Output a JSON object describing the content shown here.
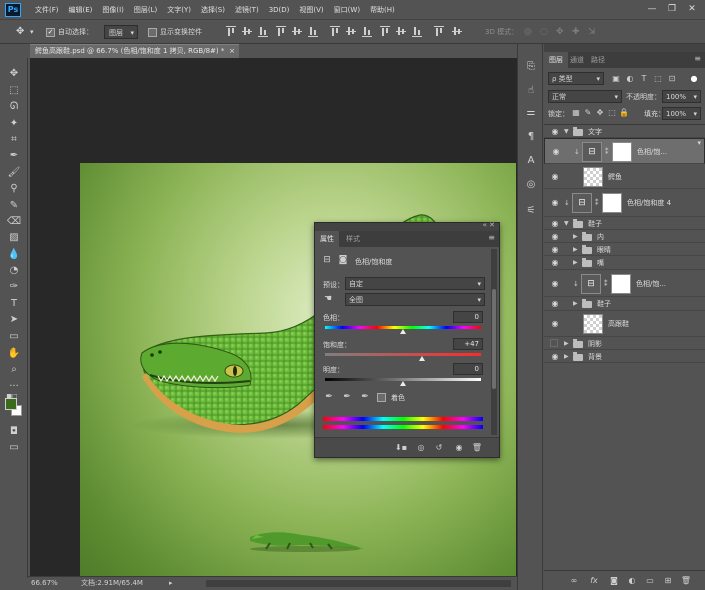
{
  "app": {
    "logo": "Ps"
  },
  "menu": [
    "文件(F)",
    "编辑(E)",
    "图像(I)",
    "图层(L)",
    "文字(Y)",
    "选择(S)",
    "滤镜(T)",
    "3D(D)",
    "视图(V)",
    "窗口(W)",
    "帮助(H)"
  ],
  "window_controls": {
    "minimize": "—",
    "restore": "❐",
    "close": "✕"
  },
  "options": {
    "auto_select_label": "自动选择：",
    "auto_select_checked": true,
    "auto_select_target": "图层",
    "show_transform_label": "显示变换控件",
    "mode_3d_label": "3D 模式："
  },
  "document": {
    "tab_title": "鳄鱼高跟鞋.psd @ 66.7% (色相/饱和度 1 拷贝, RGB/8#) *",
    "tab_close": "×",
    "zoom": "66.67%",
    "doc_info": "文档:2.91M/65.4M"
  },
  "layers_panel": {
    "tabs": [
      "图层",
      "通道",
      "路径"
    ],
    "active_tab": 0,
    "filter_kind": "ρ 类型",
    "blend_mode": "正常",
    "opacity_label": "不透明度：",
    "opacity_value": "100%",
    "lock_label": "锁定：",
    "fill_label": "填充：",
    "fill_value": "100%",
    "layers": [
      {
        "name": "文字",
        "kind": "group",
        "level": 0,
        "visible": true,
        "expanded": true
      },
      {
        "name": "色相/饱...",
        "kind": "adjustment",
        "level": 1,
        "visible": true,
        "selected": true,
        "clipped": true
      },
      {
        "name": "鳄鱼",
        "kind": "pixel",
        "level": 1,
        "visible": true
      },
      {
        "name": "色相/饱和度 4",
        "kind": "adjustment",
        "level": 0,
        "visible": true,
        "clipped": true
      },
      {
        "name": "鞋子",
        "kind": "group",
        "level": 0,
        "visible": true,
        "expanded": true
      },
      {
        "name": "内",
        "kind": "group",
        "level": 1,
        "visible": true,
        "expanded": false
      },
      {
        "name": "眼睛",
        "kind": "group",
        "level": 1,
        "visible": true,
        "expanded": false
      },
      {
        "name": "嘴",
        "kind": "group",
        "level": 1,
        "visible": true,
        "expanded": false
      },
      {
        "name": "色相/饱...",
        "kind": "adjustment",
        "level": 1,
        "visible": true,
        "clipped": true
      },
      {
        "name": "鞋子",
        "kind": "group",
        "level": 1,
        "visible": true,
        "expanded": false
      },
      {
        "name": "高跟鞋",
        "kind": "pixel",
        "level": 1,
        "visible": true
      },
      {
        "name": "阴影",
        "kind": "group",
        "level": 0,
        "visible": false,
        "expanded": false
      },
      {
        "name": "背景",
        "kind": "group",
        "level": 0,
        "visible": true,
        "expanded": false
      }
    ]
  },
  "properties": {
    "tabs": [
      "属性",
      "样式"
    ],
    "active_tab": 0,
    "adjustment_title": "色相/饱和度",
    "preset_label": "预设：",
    "preset_value": "自定",
    "channel_value": "全图",
    "hue_label": "色相：",
    "hue_value": "0",
    "saturation_label": "饱和度：",
    "saturation_value": "+47",
    "lightness_label": "明度：",
    "lightness_value": "0",
    "colorize_label": "着色",
    "colorize_checked": false,
    "slider_levels": {
      "hue": 0.5,
      "saturation": 0.62,
      "lightness": 0.5
    }
  },
  "colors": {
    "foreground": "#3c6b1e",
    "background": "#ffffff",
    "canvas_bg": "#282828"
  }
}
